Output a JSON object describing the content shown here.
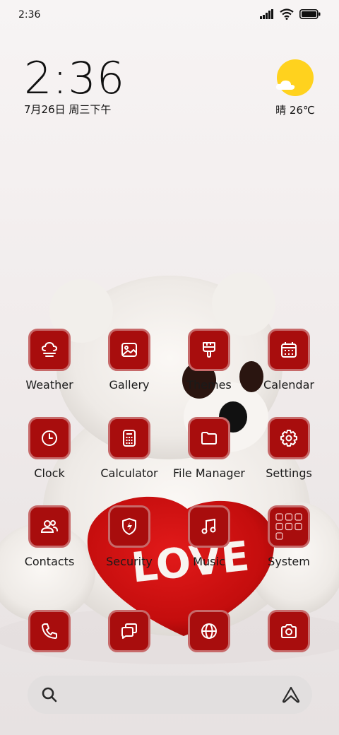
{
  "status_bar": {
    "time": "2:36",
    "icons": [
      "signal-icon",
      "wifi-icon",
      "battery-icon"
    ]
  },
  "clock_widget": {
    "time": "2:36",
    "date": "7月26日 周三下午"
  },
  "weather_widget": {
    "condition": "晴",
    "temperature": "26℃",
    "icons": [
      "sun-icon",
      "cloud-icon"
    ]
  },
  "apps": [
    {
      "label": "Weather",
      "icon": "weather-icon"
    },
    {
      "label": "Gallery",
      "icon": "gallery-icon"
    },
    {
      "label": "Themes",
      "icon": "themes-icon"
    },
    {
      "label": "Calendar",
      "icon": "calendar-icon"
    },
    {
      "label": "Clock",
      "icon": "clock-icon"
    },
    {
      "label": "Calculator",
      "icon": "calculator-icon"
    },
    {
      "label": "File Manager",
      "icon": "folder-icon"
    },
    {
      "label": "Settings",
      "icon": "gear-icon"
    },
    {
      "label": "Contacts",
      "icon": "contacts-icon"
    },
    {
      "label": "Security",
      "icon": "shield-icon"
    },
    {
      "label": "Music",
      "icon": "music-icon"
    },
    {
      "label": "System",
      "icon": "folder-grid-icon"
    }
  ],
  "dock": [
    {
      "icon": "phone-icon"
    },
    {
      "icon": "messages-icon"
    },
    {
      "icon": "browser-icon"
    },
    {
      "icon": "camera-icon"
    }
  ],
  "wallpaper_text": "LOVE",
  "colors": {
    "icon_tile": "#a80d0d",
    "icon_border": "#c76a6a",
    "sun": "#ffd21e",
    "heart": "#d91414"
  },
  "search_bar": {
    "icons": [
      "search-icon",
      "assistant-icon"
    ]
  }
}
